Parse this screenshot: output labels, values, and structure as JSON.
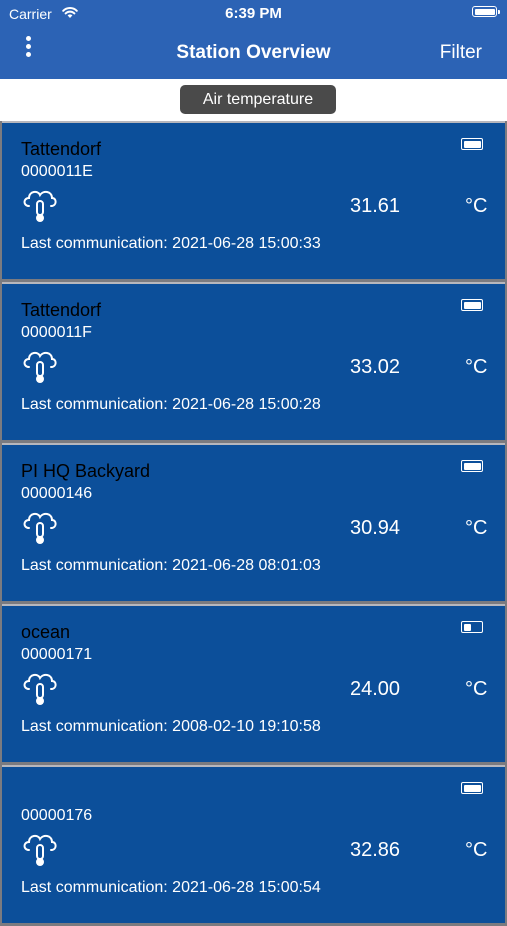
{
  "status_bar": {
    "carrier": "Carrier",
    "time": "6:39 PM"
  },
  "nav": {
    "title": "Station Overview",
    "filter": "Filter"
  },
  "filter_chip": {
    "label": "Air temperature"
  },
  "stations": [
    {
      "name": "Tattendorf",
      "id": "0000011E",
      "value": "31.61",
      "unit": "°C",
      "last_comm": "Last communication: 2021-06-28 15:00:33",
      "battery_level": 1.0
    },
    {
      "name": "Tattendorf",
      "id": "0000011F",
      "value": "33.02",
      "unit": "°C",
      "last_comm": "Last communication: 2021-06-28 15:00:28",
      "battery_level": 1.0
    },
    {
      "name": "PI HQ Backyard",
      "id": "00000146",
      "value": "30.94",
      "unit": "°C",
      "last_comm": "Last communication: 2021-06-28 08:01:03",
      "battery_level": 1.0
    },
    {
      "name": "ocean",
      "id": "00000171",
      "value": "24.00",
      "unit": "°C",
      "last_comm": "Last communication: 2008-02-10 19:10:58",
      "battery_level": 0.45
    },
    {
      "name": "",
      "id": "00000176",
      "value": "32.86",
      "unit": "°C",
      "last_comm": "Last communication: 2021-06-28 15:00:54",
      "battery_level": 1.0
    }
  ],
  "icons": {
    "sensor": "cloud-thermometer-icon",
    "battery": "battery-icon",
    "menu": "more-vertical-icon"
  },
  "colors": {
    "nav_bg": "#2c63b5",
    "card_bg": "#0c4f9a",
    "chip_bg": "#4a4a4a"
  }
}
